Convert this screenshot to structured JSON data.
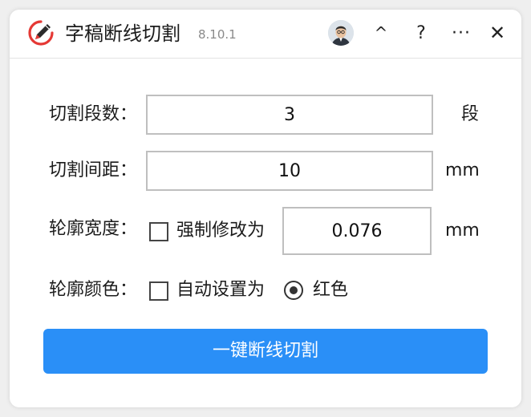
{
  "app": {
    "title": "字稿断线切割",
    "version": "8.10.1",
    "icon": "pen-in-circle-icon",
    "accent_color": "#e53935"
  },
  "titlebar": {
    "collapse_label": "^",
    "help_label": "?",
    "more_label": "···",
    "close_label": "✕"
  },
  "form": {
    "segments": {
      "label": "切割段数：",
      "value": "3",
      "unit": "段"
    },
    "spacing": {
      "label": "切割间距：",
      "value": "10",
      "unit": "mm"
    },
    "outline_width": {
      "label": "轮廓宽度：",
      "checkbox_label": "强制修改为",
      "checked": false,
      "value": "0.076",
      "unit": "mm"
    },
    "outline_color": {
      "label": "轮廓颜色：",
      "checkbox_label": "自动设置为",
      "checked": false,
      "radio_label": "红色",
      "radio_selected": true
    }
  },
  "action": {
    "button_label": "一键断线切割",
    "button_color": "#2a8ff7"
  }
}
